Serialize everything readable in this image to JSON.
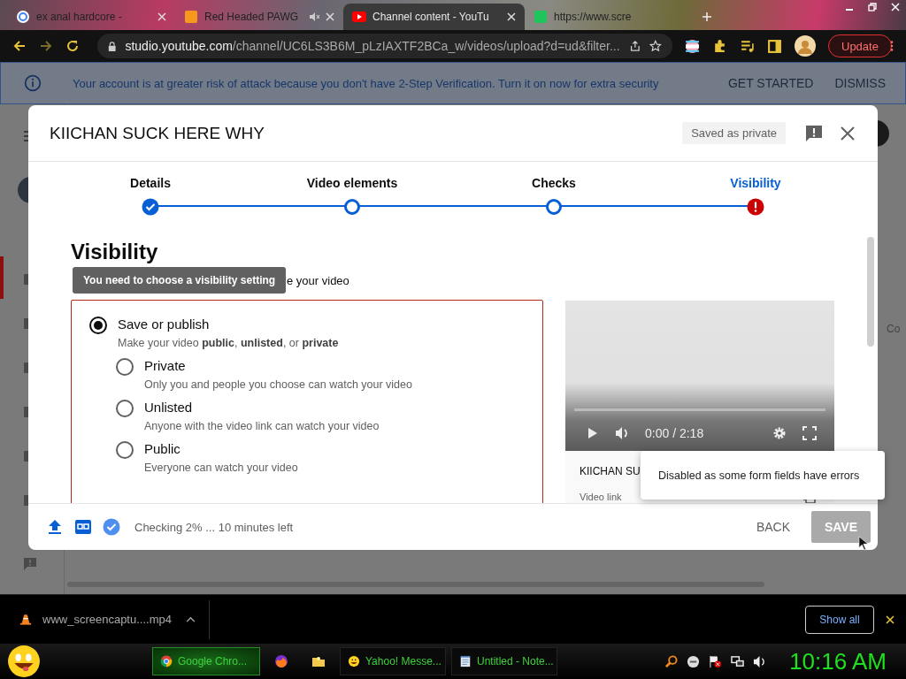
{
  "browser": {
    "tabs": [
      {
        "title": "ex anal hardcore -",
        "selected": false,
        "muted": false
      },
      {
        "title": "Red Headed PAWG",
        "selected": false,
        "muted": true
      },
      {
        "title": "Channel content - YouTu",
        "selected": true,
        "muted": false
      },
      {
        "title": "https://www.scre",
        "selected": false,
        "muted": false
      }
    ],
    "address_host": "studio.youtube.com",
    "address_path": "/channel/UC6LS3B6M_pLzIAXTF2BCa_w/videos/upload?d=ud&filter...",
    "update_button": "Update"
  },
  "banner": {
    "message": "Your account is at greater risk of attack because you don't have 2-Step Verification. Turn it on now for extra security",
    "actions": [
      "GET STARTED",
      "DISMISS"
    ]
  },
  "background": {
    "side_text": "Co"
  },
  "dialog": {
    "title": "KIICHAN SUCK HERE WHY",
    "status_chip": "Saved as private",
    "steps": [
      {
        "label": "Details",
        "done": true,
        "error": false,
        "selected": false
      },
      {
        "label": "Video elements",
        "done": false,
        "error": false,
        "selected": false
      },
      {
        "label": "Checks",
        "done": false,
        "error": false,
        "selected": false
      },
      {
        "label": "Visibility",
        "done": false,
        "error": true,
        "selected": true
      }
    ],
    "heading": "Visibility",
    "subtitle": "e your video",
    "tooltip": "You need to choose a visibility setting",
    "option": {
      "label": "Save or publish",
      "description": "Make your video **public**, **unlisted**, or **private**",
      "selected": true,
      "invalid": true,
      "children": [
        {
          "label": "Private",
          "description": "Only you and people you choose can watch your video",
          "selected": false
        },
        {
          "label": "Unlisted",
          "description": "Anyone with the video link can watch your video",
          "selected": false
        },
        {
          "label": "Public",
          "description": "Everyone can watch your video",
          "selected": false
        }
      ]
    },
    "preview": {
      "time": "0:00 / 2:18",
      "video_title": "KIICHAN SU",
      "link_label": "Video link"
    },
    "footer": {
      "status": "Checking 2% ... 10 minutes left",
      "back": "BACK",
      "save": "SAVE",
      "save_disabled": true
    },
    "error_popup": "Disabled as some form fields have errors"
  },
  "downloads": {
    "file": "www_screencaptu....mp4",
    "show_all": "Show all"
  },
  "taskbar": {
    "tasks": [
      {
        "label": "Google Chro...",
        "active": true
      },
      {
        "label": "Yahoo! Messe...",
        "active": false
      },
      {
        "label": "Untitled - Note...",
        "active": false
      }
    ],
    "clock": "10:16 AM"
  }
}
